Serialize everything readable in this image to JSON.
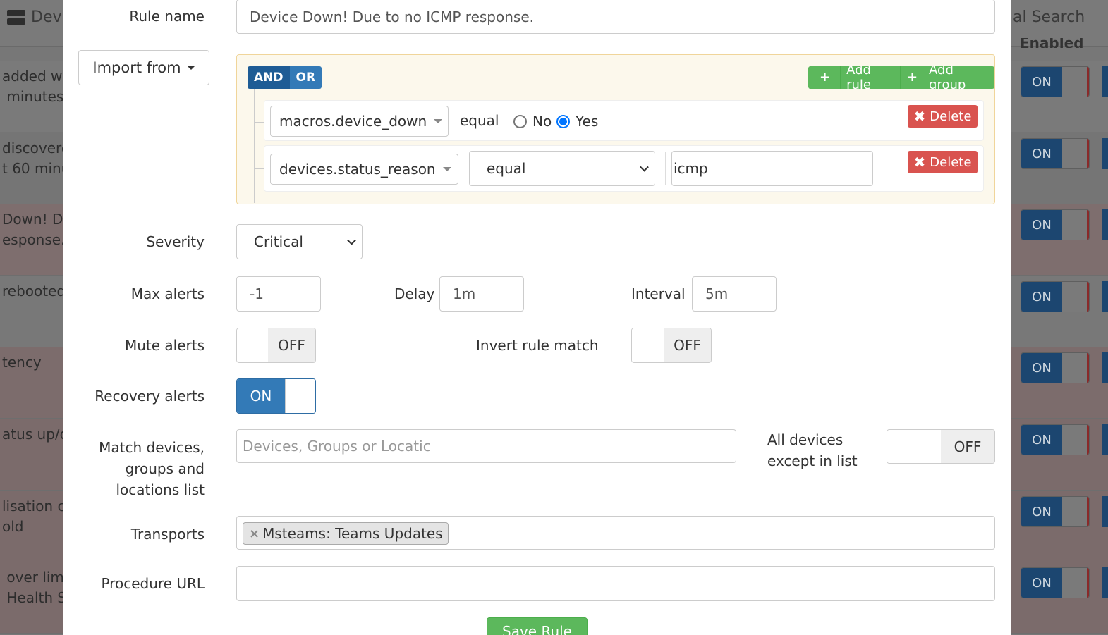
{
  "background": {
    "left_title": "Devi",
    "right_title": "al Search",
    "col_header": "Enabled",
    "rows": [
      {
        "text": "added w\n minutes",
        "toggle": "ON"
      },
      {
        "text": "discovere\nt 60 minu",
        "toggle": "ON"
      },
      {
        "text": "Down! D\nesponse.",
        "toggle": "ON"
      },
      {
        "text": "rebooted",
        "toggle": "ON"
      },
      {
        "text": "tency",
        "toggle": "ON"
      },
      {
        "text": "atus up/d",
        "toggle": "ON"
      },
      {
        "text": "lisation c\nold",
        "toggle": "ON"
      },
      {
        "text": " over lim\n Health S",
        "toggle": "ON"
      }
    ]
  },
  "form": {
    "rule_name": {
      "label": "Rule name",
      "value": "Device Down! Due to no ICMP response."
    },
    "import_from": "Import from",
    "builder": {
      "and": "AND",
      "or": "OR",
      "add_rule": "Add rule",
      "add_group": "Add group",
      "rule1": {
        "field": "macros.device_down",
        "operator": "equal",
        "no": "No",
        "yes": "Yes",
        "selected": "Yes",
        "delete": "Delete"
      },
      "rule2": {
        "field": "devices.status_reason",
        "operator": "equal",
        "value": "icmp",
        "delete": "Delete"
      }
    },
    "severity": {
      "label": "Severity",
      "value": "Critical"
    },
    "max_alerts": {
      "label": "Max alerts",
      "value": "-1"
    },
    "delay": {
      "label": "Delay",
      "value": "1m"
    },
    "interval": {
      "label": "Interval",
      "value": "5m"
    },
    "mute_alerts": {
      "label": "Mute alerts",
      "state": "OFF"
    },
    "invert_match": {
      "label": "Invert rule match",
      "state": "OFF"
    },
    "recovery_alerts": {
      "label": "Recovery alerts",
      "state": "ON"
    },
    "match_devices": {
      "label": "Match devices,\ngroups and\nlocations list",
      "placeholder": "Devices, Groups or Locatic"
    },
    "all_devices": {
      "label": "All devices\nexcept in list",
      "state": "OFF"
    },
    "transports": {
      "label": "Transports",
      "tags": [
        "Msteams: Teams Updates"
      ]
    },
    "procedure_url": {
      "label": "Procedure URL",
      "value": ""
    },
    "save": "Save Rule"
  },
  "colors": {
    "primary": "#337ab7",
    "success": "#5cb85c",
    "danger": "#d9534f",
    "builder_bg": "#fcf8ec"
  }
}
